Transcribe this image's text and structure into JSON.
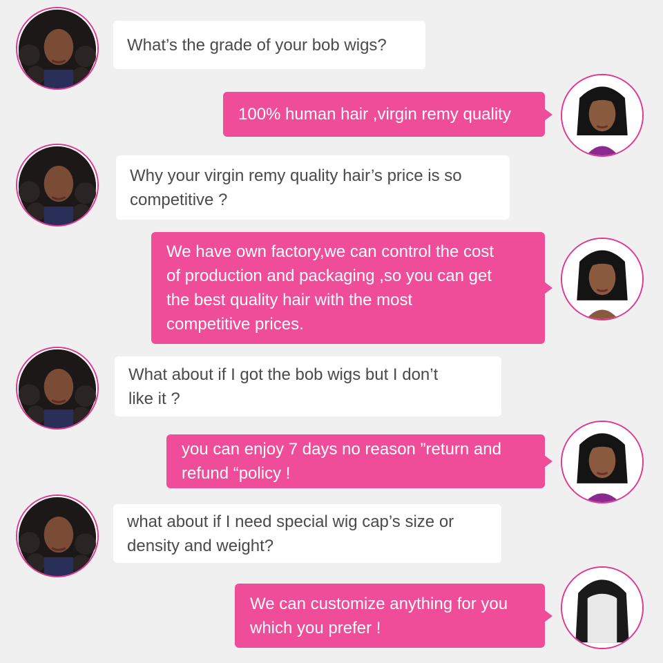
{
  "conversation": {
    "messages": [
      {
        "sender": "customer",
        "text": "What’s the grade of your bob wigs?"
      },
      {
        "sender": "seller",
        "text": "100% human hair ,virgin remy quality"
      },
      {
        "sender": "customer",
        "text": "Why your virgin remy quality hair’s  price is so\ncompetitive ?"
      },
      {
        "sender": "seller",
        "text": "We have own factory,we can control the cost\nof production and packaging ,so you can get\nthe best quality hair with the most\ncompetitive prices."
      },
      {
        "sender": "customer",
        "text": "What about if I got the bob wigs but  I don’t\nlike it ?"
      },
      {
        "sender": "seller",
        "text": "you can enjoy 7 days no reason ”return and\nrefund “policy !"
      },
      {
        "sender": "customer",
        "text": "what about if I need special wig cap’s size or\ndensity and weight?"
      },
      {
        "sender": "seller",
        "text": "We can customize anything for you\nwhich you prefer !"
      }
    ]
  },
  "colors": {
    "background": "#f0f0f1",
    "seller_bubble": "#ef4c9a",
    "customer_bubble": "#ffffff",
    "avatar_border": "#e0368e"
  },
  "avatars": {
    "customer": "curly-hair-woman-avatar",
    "seller": "bob-wig-woman-avatar"
  }
}
